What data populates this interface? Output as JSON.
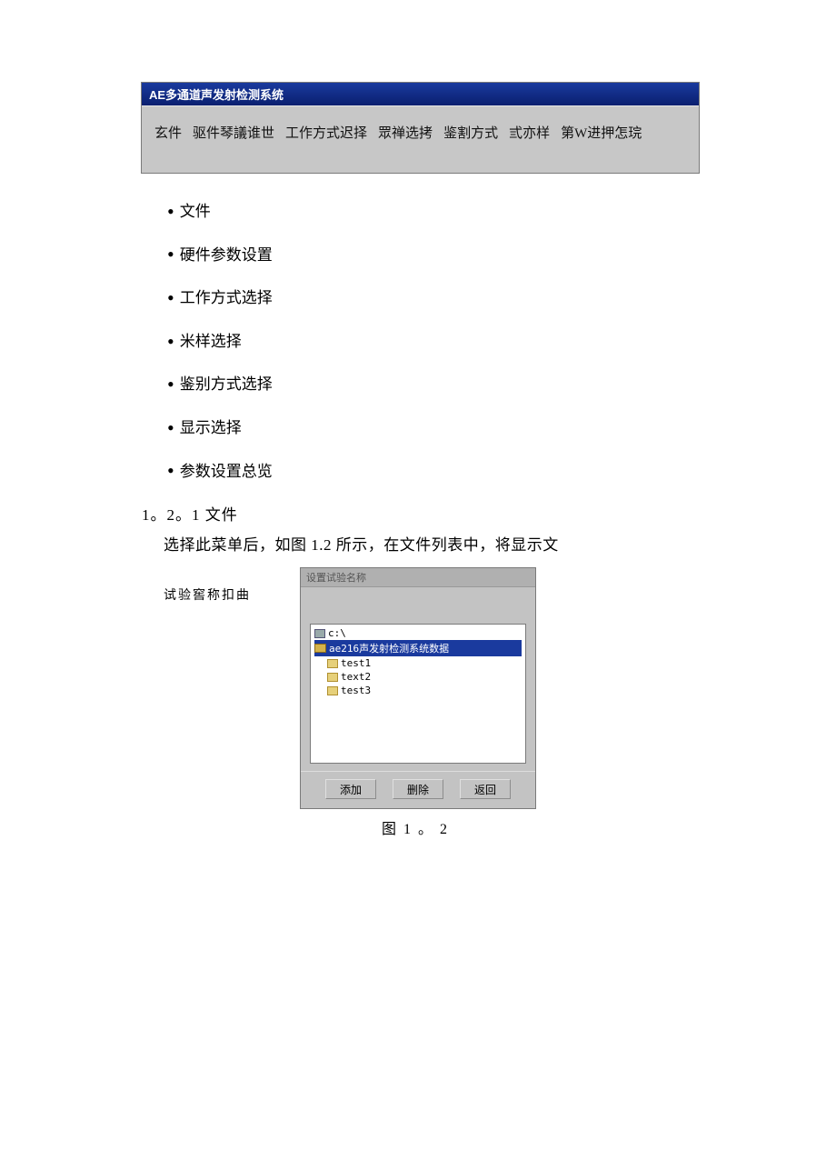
{
  "app": {
    "title": "AE多通道声发射检测系统",
    "menus": [
      "玄件",
      "驱件琴議谁世",
      "工作方式迟择",
      "眾禅选拷",
      "鉴割方式",
      "弎亦样",
      "第W进押怎琓"
    ]
  },
  "bullets": [
    "文件",
    "硬件参数设置",
    "工作方式选择",
    "米样选择",
    "鉴别方式选择",
    "显示选择",
    "参数设置总览"
  ],
  "section_num": "1。2。1 文件",
  "body_line": "选择此菜单后，如图 1.2 所示，在文件列表中，将显示文",
  "ocr_line": "试验窖称扣曲",
  "dialog": {
    "title": "设置试验名称",
    "drive": "c:\\",
    "root": "ae216声发射检测系统数据",
    "items": [
      "test1",
      "text2",
      "test3"
    ],
    "buttons": {
      "add": "添加",
      "del": "删除",
      "back": "返回"
    }
  },
  "caption": "图 1 。 2"
}
